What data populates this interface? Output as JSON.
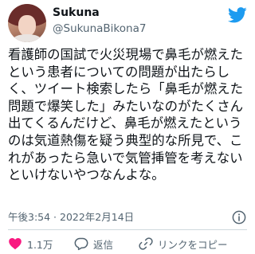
{
  "user": {
    "display_name": "Sukuna",
    "handle": "@SukunaBikona7"
  },
  "tweet": {
    "text": "看護師の国試で火災現場で鼻毛が燃えたという患者についての問題が出たらしく、ツイート検索したら「鼻毛が燃えた問題で爆笑した」みたいなのがたくさん出てくるんだけど、鼻毛が燃えたというのは気道熱傷を疑う典型的な所見で、これがあったら急いで気管挿管を考えないといけないやつなんよな。",
    "timestamp": "午後3:54 · 2022年2月14日"
  },
  "actions": {
    "like_count": "1.1万",
    "reply_label": "返信",
    "share_label": "リンクをコピー"
  },
  "icons": {
    "brand": "twitter-bird-icon",
    "info": "info-icon",
    "like": "heart-icon",
    "reply": "speech-bubble-icon",
    "share": "link-icon"
  },
  "colors": {
    "brand": "#1d9bf0",
    "like": "#f91880",
    "text": "#0f1419",
    "secondary": "#536471",
    "divider": "#cfd9de"
  }
}
